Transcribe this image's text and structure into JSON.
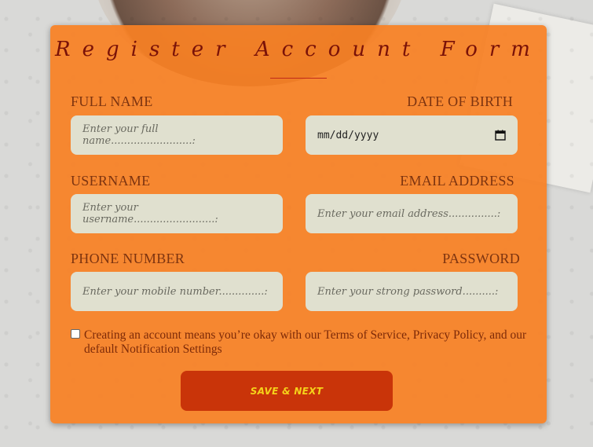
{
  "form": {
    "title": "Register Account Form",
    "fields": {
      "full_name": {
        "label": "FULL NAME",
        "placeholder": "Enter your full name.........................:"
      },
      "dob": {
        "label": "DATE OF BIRTH",
        "value": "mm/dd/yyyy"
      },
      "username": {
        "label": "USERNAME",
        "placeholder": "Enter your username.........................:"
      },
      "email": {
        "label": "EMAIL ADDRESS",
        "placeholder": "Enter your email address...............:"
      },
      "phone": {
        "label": "PHONE NUMBER",
        "placeholder": "Enter your mobile number..............:"
      },
      "password": {
        "label": "PASSWORD",
        "placeholder": "Enter your strong password..........:"
      }
    },
    "terms": "Creating an account means you’re okay with our Terms of Service, Privacy Policy, and our default Notification Settings",
    "submit_label": "SAVE & NEXT"
  },
  "colors": {
    "card": "#f78023",
    "title": "#7a1208",
    "input_bg": "#e0e0cf",
    "button": "#c93409",
    "button_text": "#f5d21a"
  }
}
